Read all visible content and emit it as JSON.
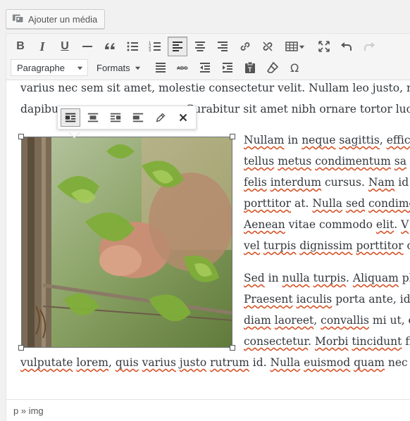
{
  "media_button": {
    "label": "Ajouter un média"
  },
  "toolbar": {
    "bold": "B",
    "italic": "I",
    "underline": "U",
    "format_select": "Paragraphe",
    "formats": "Formats"
  },
  "content": {
    "lines_top": [
      "varius nec sem sit amet, molestie consectetur velit. Nullam leo justo, n",
      "dapibus                                   Curabitur sit amet nibh ornare tortor luctus"
    ],
    "paragraph1": [
      [
        "Nullam",
        " in ",
        "neque",
        " ",
        "sagittis",
        ", ",
        "effic"
      ],
      [
        "tellus",
        " ",
        "metus",
        " ",
        "condimentum",
        " ",
        "sa"
      ],
      [
        "felis",
        " ",
        "interdum",
        " cursus. ",
        "Nam",
        " id ,"
      ],
      [
        "porttitor",
        " at. ",
        "Nulla",
        " ",
        "sed",
        " ",
        "condime"
      ],
      [
        "Aenean",
        " vitae commodo ",
        "elit",
        ". ",
        "V"
      ],
      [
        "vel",
        " ",
        "turpis",
        " ",
        "dignissim",
        " ",
        "porttitor",
        " c"
      ]
    ],
    "paragraph2": [
      [
        "Sed",
        " in ",
        "nulla",
        " ",
        "turpis",
        ". ",
        "Aliquam",
        " pl"
      ],
      [
        "Praesent",
        " ",
        "iaculis",
        " porta ante, id"
      ],
      [
        "diam",
        " ",
        "laoreet",
        ", ",
        "convallis",
        " mi ut, e"
      ],
      [
        "consectetur",
        ". ",
        "Morbi",
        " ",
        "tincidunt",
        " fi"
      ]
    ],
    "last_line": [
      "vulputate",
      " ",
      "lorem",
      ", ",
      "quis",
      " ",
      "varius",
      " ",
      "justo",
      " ",
      "rutrum",
      " id. ",
      "Nulla",
      " ",
      "euismod",
      " ",
      "quam",
      " nec"
    ]
  },
  "statusbar": {
    "path": "p » img"
  }
}
